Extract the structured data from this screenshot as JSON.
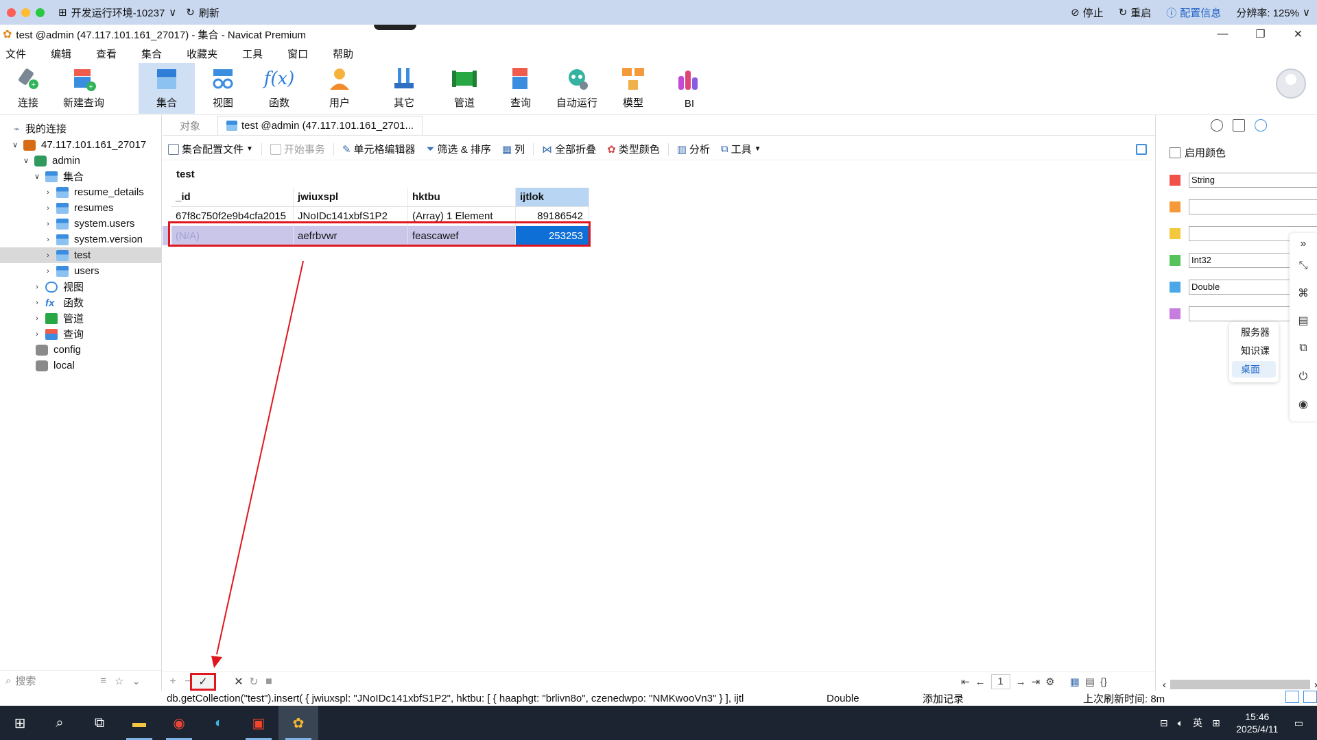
{
  "remote_bar": {
    "env_label": "开发运行环境-10237",
    "refresh_label": "刷新",
    "stop_label": "停止",
    "restart_label": "重启",
    "config_label": "配置信息",
    "resolution_label": "分辨率: 125%"
  },
  "window": {
    "title": "test @admin (47.117.101.161_27017) - 集合 - Navicat Premium"
  },
  "menu": [
    "文件",
    "编辑",
    "查看",
    "集合",
    "收藏夹",
    "工具",
    "窗口",
    "帮助"
  ],
  "toolbar": {
    "items": [
      {
        "label": "连接",
        "icon": "plug-icon"
      },
      {
        "label": "新建查询",
        "icon": "new-query-icon"
      },
      {
        "label": "集合",
        "icon": "collection-icon"
      },
      {
        "label": "视图",
        "icon": "view-icon"
      },
      {
        "label": "函数",
        "icon": "function-icon"
      },
      {
        "label": "用户",
        "icon": "user-icon"
      },
      {
        "label": "其它",
        "icon": "tools-icon"
      },
      {
        "label": "管道",
        "icon": "pipeline-icon"
      },
      {
        "label": "查询",
        "icon": "query-icon"
      },
      {
        "label": "自动运行",
        "icon": "robot-icon"
      },
      {
        "label": "模型",
        "icon": "model-icon"
      },
      {
        "label": "BI",
        "icon": "bi-icon"
      }
    ],
    "active_item": "集合"
  },
  "sidebar": {
    "root_label": "我的连接",
    "connection": "47.117.101.161_27017",
    "db_admin": "admin",
    "group_collections": "集合",
    "collections": [
      "resume_details",
      "resumes",
      "system.users",
      "system.version",
      "test",
      "users"
    ],
    "selected_collection": "test",
    "group_views": "视图",
    "group_functions": "函数",
    "group_pipelines": "管道",
    "group_queries": "查询",
    "db_config": "config",
    "db_local": "local",
    "search_placeholder": "搜索"
  },
  "tabs": {
    "objects_label": "对象",
    "active_tab_label": "test @admin (47.117.101.161_2701..."
  },
  "subtoolbar": {
    "config_file": "集合配置文件",
    "begin_txn": "开始事务",
    "cell_editor": "单元格编辑器",
    "filter_sort": "筛选 & 排序",
    "columns": "列",
    "collapse_all": "全部折叠",
    "type_color": "类型颜色",
    "analyze": "分析",
    "tools": "工具"
  },
  "grid": {
    "collection_name": "test",
    "columns": [
      "_id",
      "jwiuxspl",
      "hktbu",
      "ijtlok"
    ],
    "selected_column": "ijtlok",
    "rows": [
      {
        "_id": "67f8c750f2e9b4cfa2015",
        "jwiuxspl": "JNoIDc141xbfS1P2",
        "hktbu": "(Array) 1 Element",
        "ijtlok": "89186542"
      },
      {
        "_id": "(N/A)",
        "jwiuxspl": "aefrbvwr",
        "hktbu": "feascawef",
        "ijtlok": "253253"
      }
    ]
  },
  "grid_bar": {
    "page_number": "1"
  },
  "status_bar": {
    "sql": "db.getCollection(\"test\").insert( { jwiuxspl: \"JNoIDc141xbfS1P2\", hktbu: [ { haaphgt: \"brlivn8o\", czenedwpo: \"NMKwooVn3\" } ], ijtl",
    "field_type": "Double",
    "action": "添加记录",
    "last_refresh": "上次刷新时间: 8m"
  },
  "right_panel": {
    "enable_color_label": "启用颜色",
    "type_colors": [
      {
        "color": "#f0524a",
        "label": "String"
      },
      {
        "color": "#f59a3a",
        "label": ""
      },
      {
        "color": "#f3c83c",
        "label": ""
      },
      {
        "color": "#55c25a",
        "label": "Int32"
      },
      {
        "color": "#4aa8e8",
        "label": "Double"
      },
      {
        "color": "#c77ce0",
        "label": ""
      }
    ]
  },
  "popup_menu": {
    "items": [
      "服务器",
      "知识课",
      "桌面"
    ],
    "active": "桌面"
  },
  "taskbar": {
    "time": "15:46",
    "date": "2025/4/11",
    "ime_lang": "英"
  }
}
